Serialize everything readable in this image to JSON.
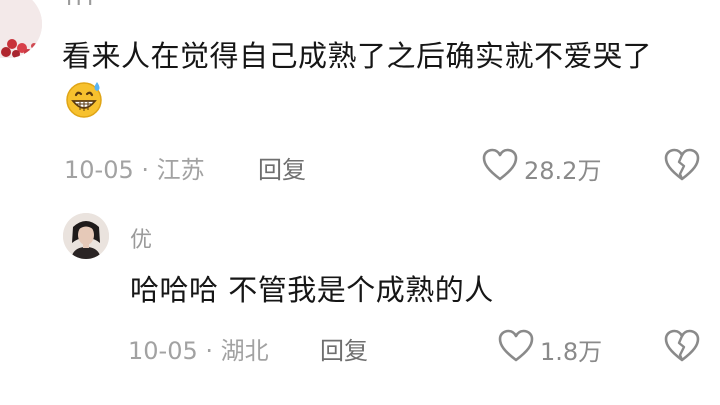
{
  "comment": {
    "username": "HY",
    "text": "看来人在觉得自己成熟了之后确实就不爱哭了",
    "emoji": "grinning-sweat-emoji",
    "date": "10-05",
    "location": "江苏",
    "date_location": "10-05 · 江苏",
    "reply_label": "回复",
    "like_count": "28.2万"
  },
  "reply": {
    "username": "优",
    "text": "哈哈哈 不管我是个成熟的人",
    "date": "10-05",
    "location": "湖北",
    "date_location": "10-05 · 湖北",
    "reply_label": "回复",
    "like_count": "1.8万"
  },
  "icons": {
    "like": "heart-outline-icon",
    "dislike": "broken-heart-icon"
  },
  "colors": {
    "text": "#161616",
    "muted": "#a2a2a2",
    "icon": "#8a8a8a",
    "emoji_face": "#f7c12e"
  }
}
